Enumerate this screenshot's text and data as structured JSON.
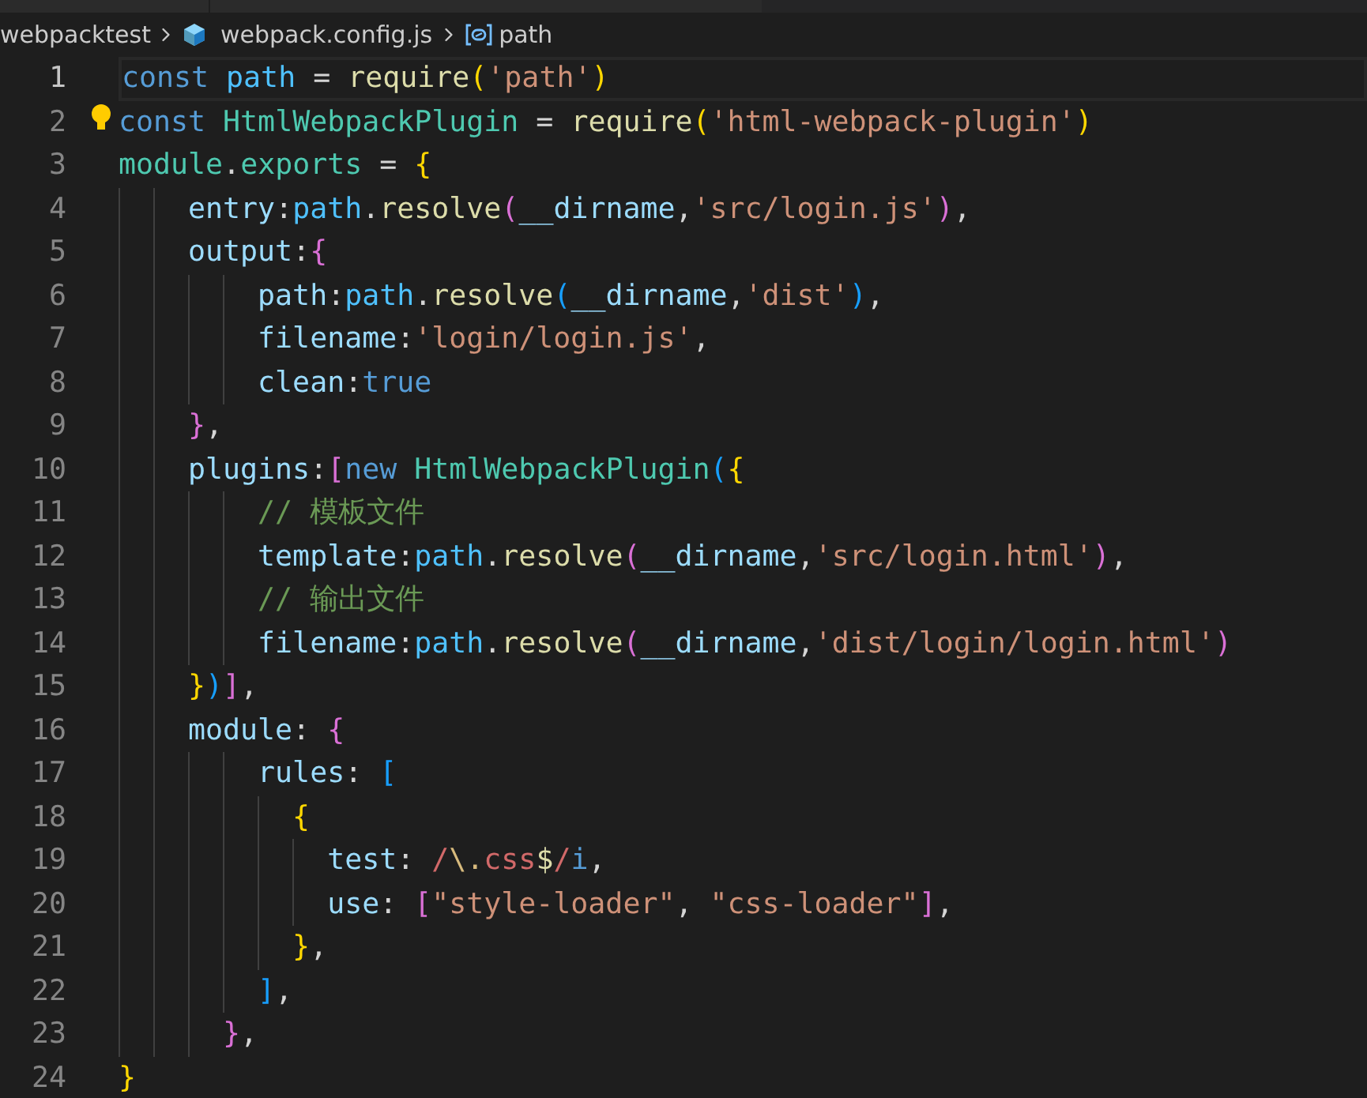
{
  "breadcrumbs": [
    {
      "text": "webpacktest",
      "kind": "folder"
    },
    {
      "text": "webpack.config.js",
      "kind": "file"
    },
    {
      "text": "path",
      "kind": "variable"
    }
  ],
  "lines": [
    {
      "number": "1",
      "current": true,
      "lightbulb": false,
      "tokens": [
        {
          "kind": "keyword",
          "text": "const "
        },
        {
          "kind": "constant",
          "text": "path"
        },
        {
          "kind": "plain",
          "text": " = "
        },
        {
          "kind": "function",
          "text": "require"
        },
        {
          "kind": "b1",
          "text": "("
        },
        {
          "kind": "string",
          "text": "'path'"
        },
        {
          "kind": "b1",
          "text": ")"
        }
      ]
    },
    {
      "number": "2",
      "current": false,
      "lightbulb": true,
      "tokens": [
        {
          "kind": "keyword",
          "text": "const "
        },
        {
          "kind": "class",
          "text": "HtmlWebpackPlugin"
        },
        {
          "kind": "plain",
          "text": " = "
        },
        {
          "kind": "function",
          "text": "require"
        },
        {
          "kind": "b1",
          "text": "("
        },
        {
          "kind": "string",
          "text": "'html-webpack-plugin'"
        },
        {
          "kind": "b1",
          "text": ")"
        }
      ]
    },
    {
      "number": "3",
      "current": false,
      "lightbulb": false,
      "tokens": [
        {
          "kind": "class",
          "text": "module"
        },
        {
          "kind": "plain",
          "text": "."
        },
        {
          "kind": "class",
          "text": "exports"
        },
        {
          "kind": "plain",
          "text": " = "
        },
        {
          "kind": "b1",
          "text": "{"
        }
      ]
    },
    {
      "number": "4",
      "current": false,
      "lightbulb": false,
      "tokens": [
        {
          "kind": "property",
          "text": "    entry"
        },
        {
          "kind": "plain",
          "text": ":"
        },
        {
          "kind": "constant",
          "text": "path"
        },
        {
          "kind": "plain",
          "text": "."
        },
        {
          "kind": "function",
          "text": "resolve"
        },
        {
          "kind": "b2",
          "text": "("
        },
        {
          "kind": "property",
          "text": "__dirname"
        },
        {
          "kind": "plain",
          "text": ","
        },
        {
          "kind": "string",
          "text": "'src/login.js'"
        },
        {
          "kind": "b2",
          "text": ")"
        },
        {
          "kind": "plain",
          "text": ","
        }
      ]
    },
    {
      "number": "5",
      "current": false,
      "lightbulb": false,
      "tokens": [
        {
          "kind": "property",
          "text": "    output"
        },
        {
          "kind": "plain",
          "text": ":"
        },
        {
          "kind": "b2",
          "text": "{"
        }
      ]
    },
    {
      "number": "6",
      "current": false,
      "lightbulb": false,
      "tokens": [
        {
          "kind": "property",
          "text": "        path"
        },
        {
          "kind": "plain",
          "text": ":"
        },
        {
          "kind": "constant",
          "text": "path"
        },
        {
          "kind": "plain",
          "text": "."
        },
        {
          "kind": "function",
          "text": "resolve"
        },
        {
          "kind": "b3",
          "text": "("
        },
        {
          "kind": "property",
          "text": "__dirname"
        },
        {
          "kind": "plain",
          "text": ","
        },
        {
          "kind": "string",
          "text": "'dist'"
        },
        {
          "kind": "b3",
          "text": ")"
        },
        {
          "kind": "plain",
          "text": ","
        }
      ]
    },
    {
      "number": "7",
      "current": false,
      "lightbulb": false,
      "tokens": [
        {
          "kind": "property",
          "text": "        filename"
        },
        {
          "kind": "plain",
          "text": ":"
        },
        {
          "kind": "string",
          "text": "'login/login.js'"
        },
        {
          "kind": "plain",
          "text": ","
        }
      ]
    },
    {
      "number": "8",
      "current": false,
      "lightbulb": false,
      "tokens": [
        {
          "kind": "property",
          "text": "        clean"
        },
        {
          "kind": "plain",
          "text": ":"
        },
        {
          "kind": "keyword",
          "text": "true"
        }
      ]
    },
    {
      "number": "9",
      "current": false,
      "lightbulb": false,
      "tokens": [
        {
          "kind": "b2",
          "text": "    }"
        },
        {
          "kind": "plain",
          "text": ","
        }
      ]
    },
    {
      "number": "10",
      "current": false,
      "lightbulb": false,
      "tokens": [
        {
          "kind": "property",
          "text": "    plugins"
        },
        {
          "kind": "plain",
          "text": ":"
        },
        {
          "kind": "b2",
          "text": "["
        },
        {
          "kind": "keyword",
          "text": "new "
        },
        {
          "kind": "class",
          "text": "HtmlWebpackPlugin"
        },
        {
          "kind": "b3",
          "text": "("
        },
        {
          "kind": "b1",
          "text": "{"
        }
      ]
    },
    {
      "number": "11",
      "current": false,
      "lightbulb": false,
      "tokens": [
        {
          "kind": "comment",
          "text": "        // 模板文件"
        }
      ]
    },
    {
      "number": "12",
      "current": false,
      "lightbulb": false,
      "tokens": [
        {
          "kind": "property",
          "text": "        template"
        },
        {
          "kind": "plain",
          "text": ":"
        },
        {
          "kind": "constant",
          "text": "path"
        },
        {
          "kind": "plain",
          "text": "."
        },
        {
          "kind": "function",
          "text": "resolve"
        },
        {
          "kind": "b2",
          "text": "("
        },
        {
          "kind": "property",
          "text": "__dirname"
        },
        {
          "kind": "plain",
          "text": ","
        },
        {
          "kind": "string",
          "text": "'src/login.html'"
        },
        {
          "kind": "b2",
          "text": ")"
        },
        {
          "kind": "plain",
          "text": ","
        }
      ]
    },
    {
      "number": "13",
      "current": false,
      "lightbulb": false,
      "tokens": [
        {
          "kind": "comment",
          "text": "        // 输出文件"
        }
      ]
    },
    {
      "number": "14",
      "current": false,
      "lightbulb": false,
      "tokens": [
        {
          "kind": "property",
          "text": "        filename"
        },
        {
          "kind": "plain",
          "text": ":"
        },
        {
          "kind": "constant",
          "text": "path"
        },
        {
          "kind": "plain",
          "text": "."
        },
        {
          "kind": "function",
          "text": "resolve"
        },
        {
          "kind": "b2",
          "text": "("
        },
        {
          "kind": "property",
          "text": "__dirname"
        },
        {
          "kind": "plain",
          "text": ","
        },
        {
          "kind": "string",
          "text": "'dist/login/login.html'"
        },
        {
          "kind": "b2",
          "text": ")"
        }
      ]
    },
    {
      "number": "15",
      "current": false,
      "lightbulb": false,
      "tokens": [
        {
          "kind": "b1",
          "text": "    }"
        },
        {
          "kind": "b3",
          "text": ")"
        },
        {
          "kind": "b2",
          "text": "]"
        },
        {
          "kind": "plain",
          "text": ","
        }
      ]
    },
    {
      "number": "16",
      "current": false,
      "lightbulb": false,
      "tokens": [
        {
          "kind": "property",
          "text": "    module"
        },
        {
          "kind": "plain",
          "text": ": "
        },
        {
          "kind": "b2",
          "text": "{"
        }
      ]
    },
    {
      "number": "17",
      "current": false,
      "lightbulb": false,
      "tokens": [
        {
          "kind": "property",
          "text": "        rules"
        },
        {
          "kind": "plain",
          "text": ": "
        },
        {
          "kind": "b3",
          "text": "["
        }
      ]
    },
    {
      "number": "18",
      "current": false,
      "lightbulb": false,
      "tokens": [
        {
          "kind": "b1",
          "text": "          {"
        }
      ]
    },
    {
      "number": "19",
      "current": false,
      "lightbulb": false,
      "tokens": [
        {
          "kind": "property",
          "text": "            test"
        },
        {
          "kind": "plain",
          "text": ": "
        },
        {
          "kind": "regex",
          "text": "/"
        },
        {
          "kind": "escape",
          "text": "\\."
        },
        {
          "kind": "regex",
          "text": "css"
        },
        {
          "kind": "anchor",
          "text": "$"
        },
        {
          "kind": "regex",
          "text": "/"
        },
        {
          "kind": "keyword",
          "text": "i"
        },
        {
          "kind": "plain",
          "text": ","
        }
      ]
    },
    {
      "number": "20",
      "current": false,
      "lightbulb": false,
      "tokens": [
        {
          "kind": "property",
          "text": "            use"
        },
        {
          "kind": "plain",
          "text": ": "
        },
        {
          "kind": "b2",
          "text": "["
        },
        {
          "kind": "string",
          "text": "\"style-loader\""
        },
        {
          "kind": "plain",
          "text": ", "
        },
        {
          "kind": "string",
          "text": "\"css-loader\""
        },
        {
          "kind": "b2",
          "text": "]"
        },
        {
          "kind": "plain",
          "text": ","
        }
      ]
    },
    {
      "number": "21",
      "current": false,
      "lightbulb": false,
      "tokens": [
        {
          "kind": "b1",
          "text": "          }"
        },
        {
          "kind": "plain",
          "text": ","
        }
      ]
    },
    {
      "number": "22",
      "current": false,
      "lightbulb": false,
      "tokens": [
        {
          "kind": "b3",
          "text": "        ]"
        },
        {
          "kind": "plain",
          "text": ","
        }
      ]
    },
    {
      "number": "23",
      "current": false,
      "lightbulb": false,
      "tokens": [
        {
          "kind": "b2",
          "text": "      }"
        },
        {
          "kind": "plain",
          "text": ","
        }
      ]
    },
    {
      "number": "24",
      "current": false,
      "lightbulb": false,
      "tokens": [
        {
          "kind": "b1",
          "text": "}"
        }
      ]
    }
  ]
}
